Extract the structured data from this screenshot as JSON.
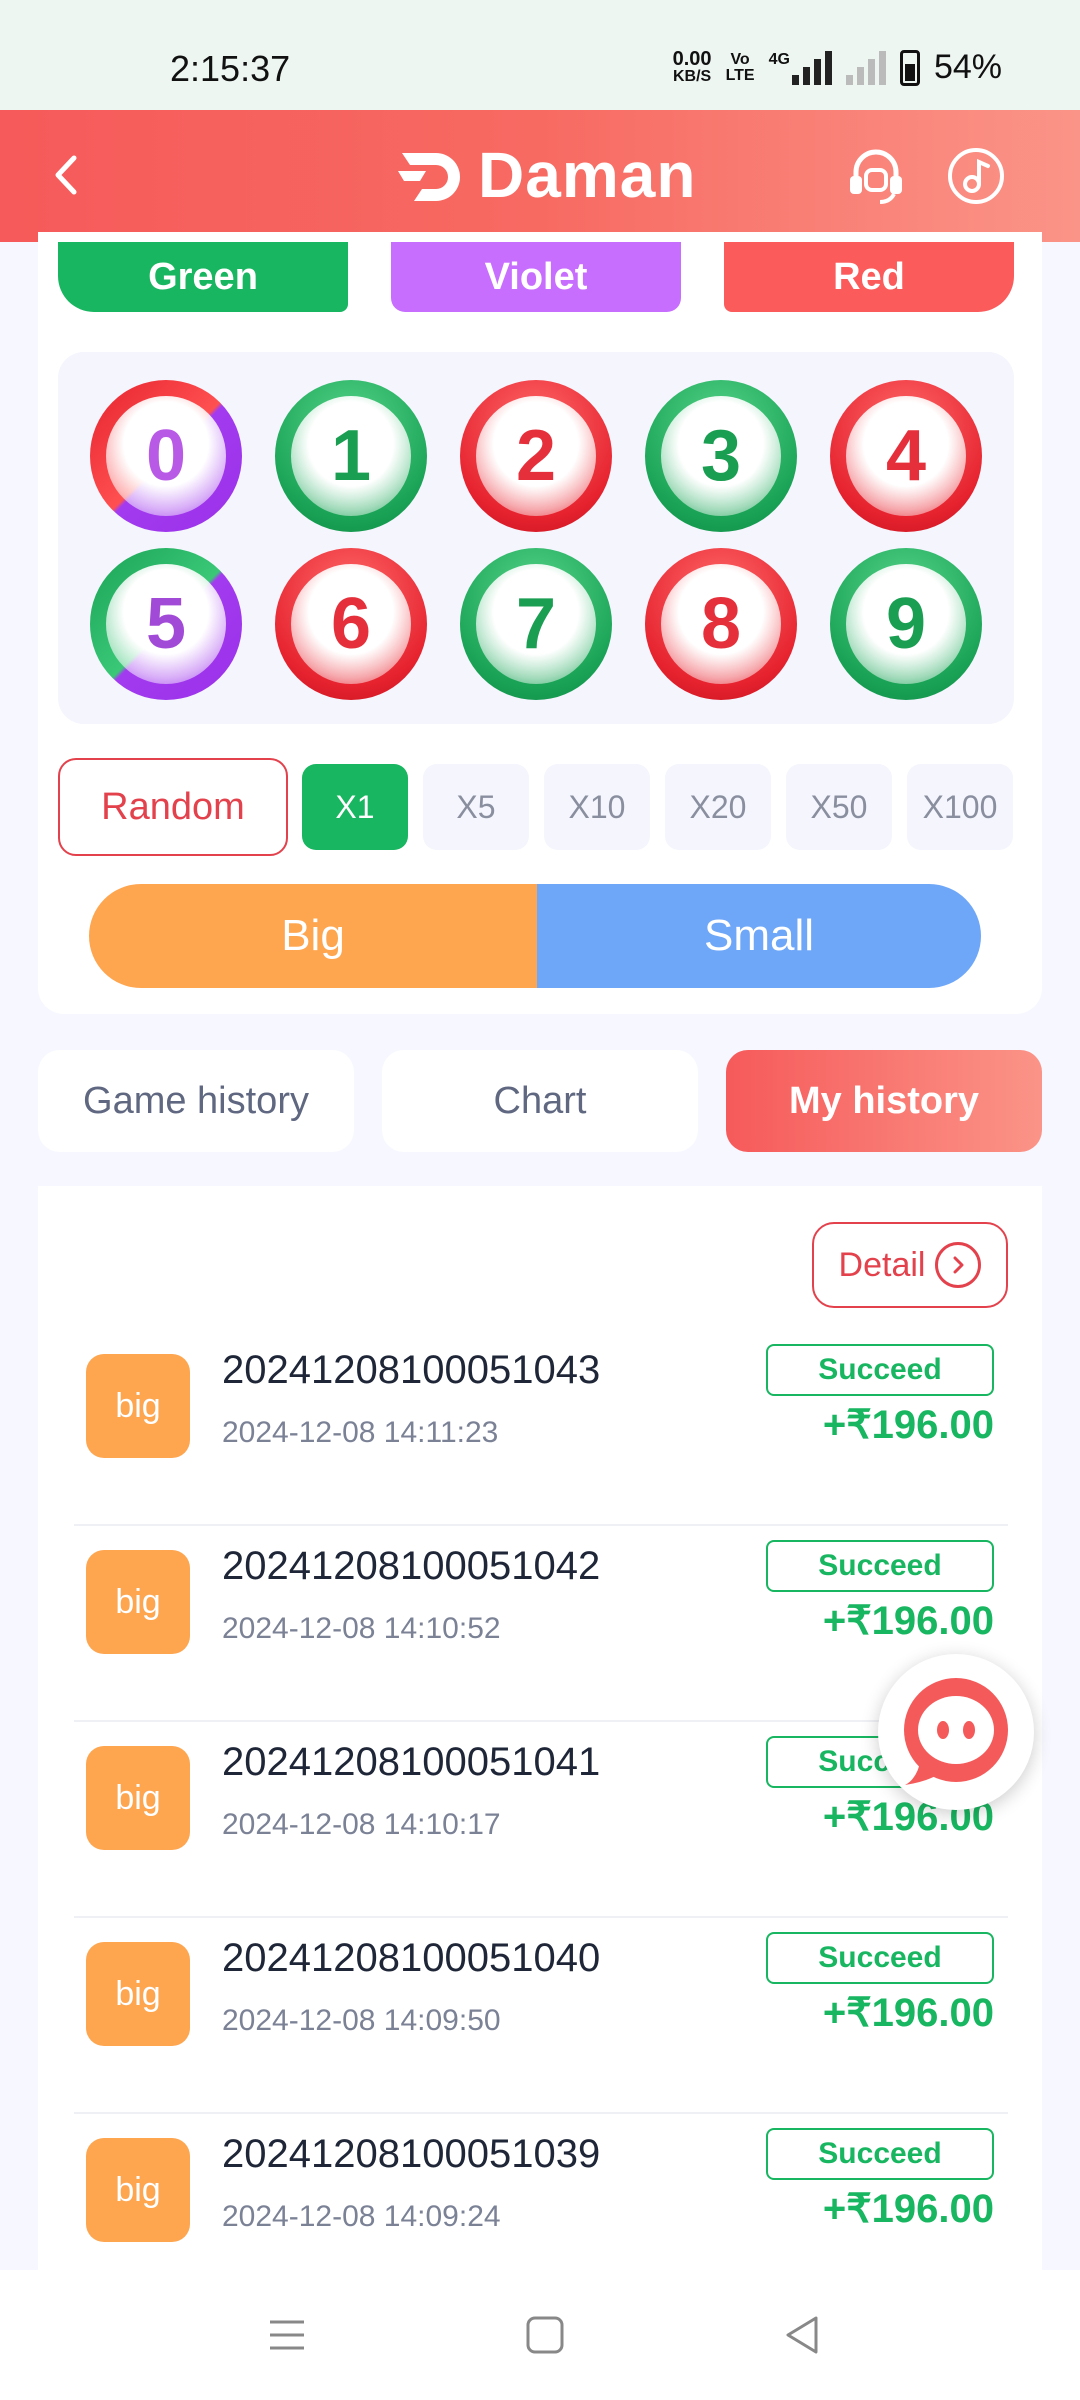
{
  "status_bar": {
    "time": "2:15:37",
    "net_speed_value": "0.00",
    "net_speed_unit": "KB/S",
    "volte_top": "Vo",
    "volte_bottom": "LTE",
    "network": "4G",
    "battery": "54%"
  },
  "header": {
    "logo_text": "Daman",
    "brand_gradient": [
      "#f65a5a",
      "#fb9488"
    ]
  },
  "color_buttons": {
    "green": "Green",
    "violet": "Violet",
    "red": "Red"
  },
  "number_balls": [
    {
      "label": "0",
      "color": "red-violet"
    },
    {
      "label": "1",
      "color": "green"
    },
    {
      "label": "2",
      "color": "red"
    },
    {
      "label": "3",
      "color": "green"
    },
    {
      "label": "4",
      "color": "red"
    },
    {
      "label": "5",
      "color": "green-violet"
    },
    {
      "label": "6",
      "color": "red"
    },
    {
      "label": "7",
      "color": "green"
    },
    {
      "label": "8",
      "color": "red"
    },
    {
      "label": "9",
      "color": "green"
    }
  ],
  "multipliers": {
    "random": "Random",
    "options": [
      "X1",
      "X5",
      "X10",
      "X20",
      "X50",
      "X100"
    ],
    "selected": "X1"
  },
  "big_small": {
    "big": "Big",
    "small": "Small"
  },
  "tabs": [
    "Game history",
    "Chart",
    "My history"
  ],
  "active_tab": "My history",
  "history": {
    "detail_label": "Detail",
    "rows": [
      {
        "bet": "big",
        "period": "20241208100051043",
        "time": "2024-12-08 14:11:23",
        "status": "Succeed",
        "amount": "+₹196.00"
      },
      {
        "bet": "big",
        "period": "20241208100051042",
        "time": "2024-12-08 14:10:52",
        "status": "Succeed",
        "amount": "+₹196.00"
      },
      {
        "bet": "big",
        "period": "20241208100051041",
        "time": "2024-12-08 14:10:17",
        "status": "Succeed",
        "amount": "+₹196.00"
      },
      {
        "bet": "big",
        "period": "20241208100051040",
        "time": "2024-12-08 14:09:50",
        "status": "Succeed",
        "amount": "+₹196.00"
      },
      {
        "bet": "big",
        "period": "20241208100051039",
        "time": "2024-12-08 14:09:24",
        "status": "Succeed",
        "amount": "+₹196.00"
      }
    ]
  },
  "icons": {
    "back": "chevron-left-icon",
    "support": "headset-icon",
    "music": "music-note-icon",
    "chat": "chat-bubble-icon",
    "nav_menu": "menu-icon",
    "nav_home": "square-home-icon",
    "nav_back": "triangle-back-icon"
  }
}
